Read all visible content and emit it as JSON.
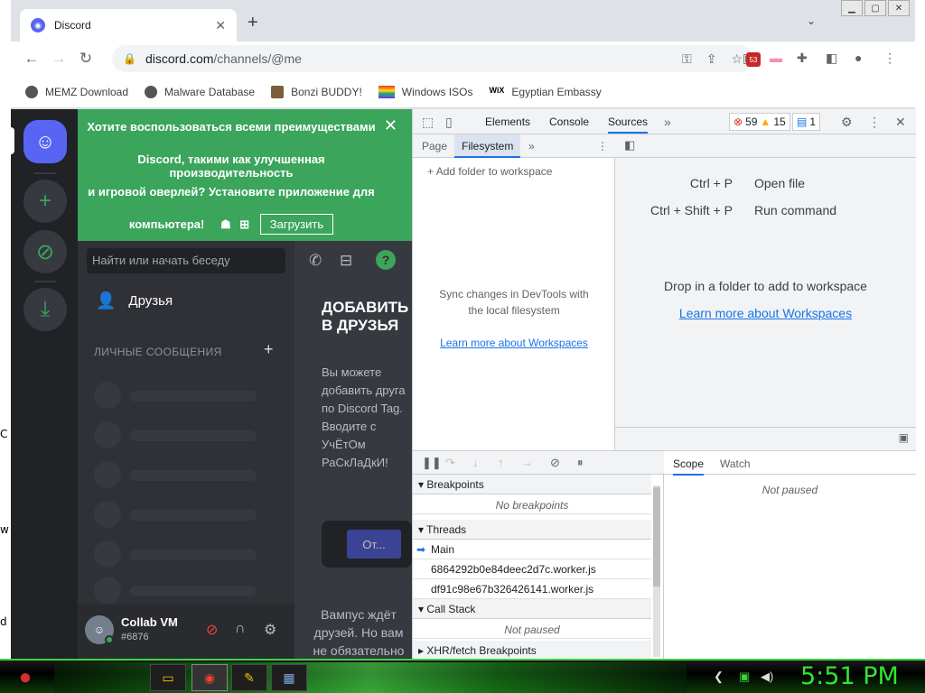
{
  "desktop": {
    "edge_letters": [
      "C",
      "w",
      "d"
    ]
  },
  "browser": {
    "tab_title": "Discord",
    "url_host": "discord.com",
    "url_path": "/channels/@me",
    "ext_badge": "53",
    "bookmarks": [
      "MEMZ Download",
      "Malware Database",
      "Bonzi BUDDY!",
      "Windows ISOs",
      "Egyptian Embassy"
    ]
  },
  "discord": {
    "banner": {
      "line1": "Хотите воспользоваться всеми преимуществами",
      "line2": "Discord, такими как улучшенная производительность",
      "line3": "и игровой оверлей? Установите приложение для",
      "line4": "компьютера!",
      "download_label": "Загрузить"
    },
    "search_placeholder": "Найти или начать беседу",
    "friends_label": "Друзья",
    "dm_header": "ЛИЧНЫЕ СООБЩЕНИЯ",
    "add_friends_title": "ДОБАВИТЬ В ДРУЗЬЯ",
    "add_friends_desc": "Вы можете добавить друга по Discord Tag. Вводите с УчЁтОм РаСкЛаДкИ!",
    "send_label": "От...",
    "wumpus_text": "Вампус ждёт друзей. Но вам не обязательно ему",
    "user": {
      "name": "Collab VM",
      "tag": "#6876"
    }
  },
  "devtools": {
    "tabs": [
      "Elements",
      "Console",
      "Sources"
    ],
    "active_tab": "Sources",
    "errors": "59",
    "warnings": "15",
    "messages": "1",
    "nav_tabs": [
      "Page",
      "Filesystem"
    ],
    "add_folder": "Add folder to workspace",
    "fs_note": "Sync changes in DevTools with the local filesystem",
    "fs_link": "Learn more about Workspaces",
    "shortcuts": [
      {
        "key": "Ctrl + P",
        "action": "Open file"
      },
      {
        "key": "Ctrl + Shift + P",
        "action": "Run command"
      }
    ],
    "drop_text": "Drop in a folder to add to workspace",
    "ws_link": "Learn more about Workspaces",
    "sections": {
      "breakpoints": "Breakpoints",
      "no_breakpoints": "No breakpoints",
      "threads": "Threads",
      "thread_main": "Main",
      "thread_1": "6864292b0e84deec2d7c.worker.js",
      "thread_2": "df91c98e67b326426141.worker.js",
      "call_stack": "Call Stack",
      "not_paused": "Not paused",
      "xhr": "XHR/fetch Breakpoints"
    },
    "scope_tabs": [
      "Scope",
      "Watch"
    ],
    "scope_not_paused": "Not paused"
  },
  "taskbar": {
    "clock": "5:51 PM"
  }
}
